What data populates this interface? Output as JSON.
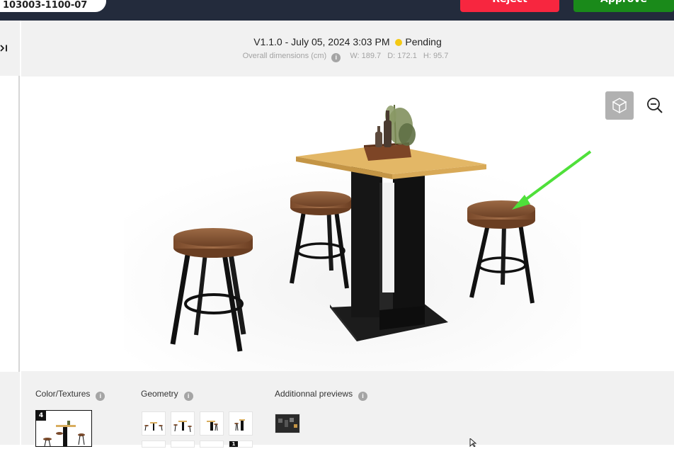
{
  "topbar": {
    "id_text": "103003-1100-07",
    "reject_label": "Reject",
    "approve_label": "Approve"
  },
  "header": {
    "version": "V1.1.0",
    "separator": "-",
    "date": "July 05, 2024 3:03 PM",
    "status": "Pending",
    "dims_label": "Overall dimensions (cm)",
    "width": "W: 189.7",
    "depth": "D: 172.1",
    "height": "H: 95.7"
  },
  "sidebar": {
    "collapse_icon": "collapse-right-icon"
  },
  "viewer": {
    "view_mode_icon": "cube-icon",
    "zoom_icon": "zoom-out-icon"
  },
  "bottom": {
    "color_textures_label": "Color/Textures",
    "geometry_label": "Geometry",
    "previews_label": "Additionnal previews",
    "color_badge": "4",
    "geometry_badge": "1"
  },
  "colors": {
    "topbar": "#232b3c",
    "reject": "#f7263f",
    "approve": "#1a8a1a",
    "status_pending": "#f4c914",
    "annotation_arrow": "#4fe03a",
    "panel_bg": "#f1f1f1"
  }
}
